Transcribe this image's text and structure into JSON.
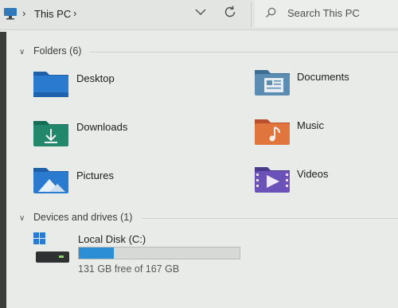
{
  "address_bar": {
    "location": "This PC",
    "icons": {
      "pc": "computer-icon",
      "dropdown": "chevron-down-icon",
      "refresh": "refresh-icon"
    }
  },
  "search": {
    "placeholder": "Search This PC",
    "icon": "search-icon"
  },
  "folders_section": {
    "title": "Folders (6)",
    "items": [
      {
        "label": "Desktop",
        "icon": "desktop-folder-icon"
      },
      {
        "label": "Documents",
        "icon": "documents-folder-icon"
      },
      {
        "label": "Downloads",
        "icon": "downloads-folder-icon"
      },
      {
        "label": "Music",
        "icon": "music-folder-icon"
      },
      {
        "label": "Pictures",
        "icon": "pictures-folder-icon"
      },
      {
        "label": "Videos",
        "icon": "videos-folder-icon"
      }
    ]
  },
  "drives_section": {
    "title": "Devices and drives (1)",
    "drives": [
      {
        "label": "Local Disk (C:)",
        "free_text": "131 GB free of 167 GB",
        "used_fraction": 0.2156,
        "icon": "local-disk-icon"
      }
    ]
  },
  "colors": {
    "accent": "#2c8fd6",
    "background": "#e9ebe8"
  }
}
